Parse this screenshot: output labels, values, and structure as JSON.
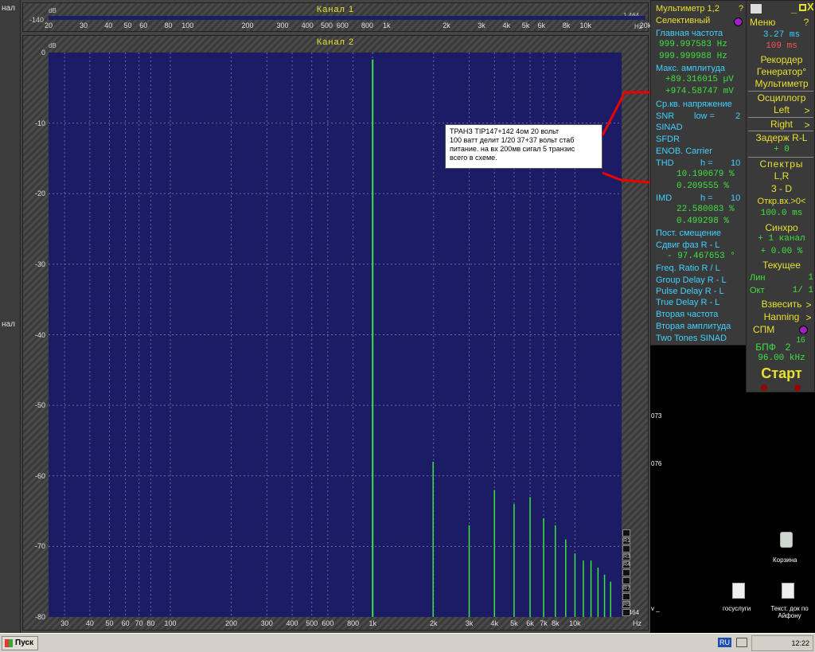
{
  "left_strip": {
    "top": "нал",
    "mid": "нал"
  },
  "channel1": {
    "title": "Канал 1",
    "db": "dB",
    "scale_left": "-140",
    "scale_right": "1.464",
    "hz": "Hz",
    "ticks": [
      "20",
      "30",
      "40",
      "50",
      "60",
      "80",
      "100",
      "1k",
      "200",
      "300",
      "400",
      "500",
      "600",
      "800",
      "2k",
      "3k",
      "4k",
      "5k",
      "6k",
      "8k",
      "10k",
      "20k"
    ]
  },
  "channel2": {
    "title": "Канал 2",
    "db": "dB",
    "ylabels": [
      "0",
      "-10",
      "-20",
      "-30",
      "-40",
      "-50",
      "-60",
      "-70",
      "-80"
    ],
    "xlabels": [
      "30",
      "40",
      "50",
      "60",
      "70",
      "80",
      "100",
      "200",
      "300",
      "400",
      "500",
      "600",
      "800",
      "1k",
      "2k",
      "3k",
      "4k",
      "5k",
      "6k",
      "7k",
      "8k",
      "10k"
    ],
    "hz": "Hz",
    "scale_right": "1.464"
  },
  "chart_data": {
    "type": "bar",
    "xlabel": "",
    "ylabel": "dB",
    "ylim": [
      -80,
      0
    ],
    "x_scale": "log",
    "x_hz": [
      1000,
      1990,
      3000,
      4000,
      5000,
      6000,
      7000,
      8000,
      9000,
      10000,
      11000,
      12000,
      13000,
      14000,
      15000
    ],
    "values_db": [
      -1,
      -58,
      -67,
      -62,
      -64,
      -63,
      -66,
      -67,
      -69,
      -71,
      -72,
      -72,
      -73,
      -74,
      -75
    ]
  },
  "annotation": {
    "lines": [
      "ТРАНЗ TIP147+142  4ом  20 вольт",
      "100 ватт  делит 1/20  37+37 вольт стаб",
      "питание. на вх 200мв сигал  5 транзис",
      "всего в схеме."
    ]
  },
  "ranges": [
    "R1",
    "R3",
    "R4",
    "R7",
    "R9"
  ],
  "meters": {
    "title": "Мультиметр 1,2",
    "help": "?",
    "selective": "Селективный",
    "main_freq": "Главная частота",
    "freq1": "999.997583 Hz",
    "freq2": "999.999988 Hz",
    "max_amp": "Макс. амплитуда",
    "amp1": "+89.316015 µV",
    "amp2": "+974.58747 mV",
    "rms": "Ср.кв. напряжение",
    "snr": "SNR",
    "low": "low =",
    "low_val": "2",
    "sinad": "SINAD",
    "sfdr": "SFDR",
    "enob": "ENOB. Carrier",
    "thd": "THD",
    "h": "h =",
    "h_val": "10",
    "thd1": "10.190679 %",
    "thd2": "0.209555 %",
    "imd": "IMD",
    "imd_h_val": "10",
    "imd1": "22.580083 %",
    "imd2": "0.499298 %",
    "dc": "Пост. смещение",
    "phase": "Сдвиг фаз R - L",
    "phase_val": "- 97.467653 °",
    "freq_ratio": "Freq. Ratio  R / L",
    "group_delay": "Group Delay R - L",
    "pulse_delay": "Pulse Delay R - L",
    "true_delay": "True Delay R - L",
    "second_freq": "Вторая частота",
    "second_amp": "Вторая амплитуда",
    "two_tones": "Two Tones SINAD"
  },
  "menu": {
    "menu": "Меню",
    "help": "?",
    "close": "X",
    "t1": "3.27 ms",
    "t2": "109 ms",
    "recorder": "Рекордер",
    "generator": "Генератор°",
    "multimeter": "Мультиметр",
    "oscillograph": "Осциллогр",
    "left": "Left",
    "right": "Right",
    "delay": "Задерж R-L",
    "delay_val": "+   0",
    "spectra": "Спектры",
    "lr": "L,R",
    "threed": "3 - D",
    "open_in": "Откр.вх.>0<",
    "open_val": "100.0 ms",
    "sync": "Синхро",
    "sync1": "+ 1 канал",
    "sync2": "+ 0.00 %",
    "current": "Текущее",
    "lin": "Лин",
    "lin_val": "1",
    "oct": "Окт",
    "oct_val": "1/ 1",
    "weigh": "Взвесить",
    "hanning": "Hanning",
    "spm": "СПМ",
    "fft": "БПФ",
    "fft_val": "2",
    "fft_exp": "16",
    "rate": "96.00 kHz",
    "start": "Старт"
  },
  "desktop": {
    "side1": "073",
    "side2": "076",
    "recycle": "Корзина",
    "gosuslugi": "госуслуги",
    "doc": "Текст. док по Айфону",
    "side3": "v _"
  },
  "taskbar": {
    "start": "Пуск",
    "lang": "RU",
    "time": "12:22"
  },
  "colors": {
    "plot_bg": "#1b1b66",
    "trace": "#39e639",
    "label": "#e8e030"
  }
}
